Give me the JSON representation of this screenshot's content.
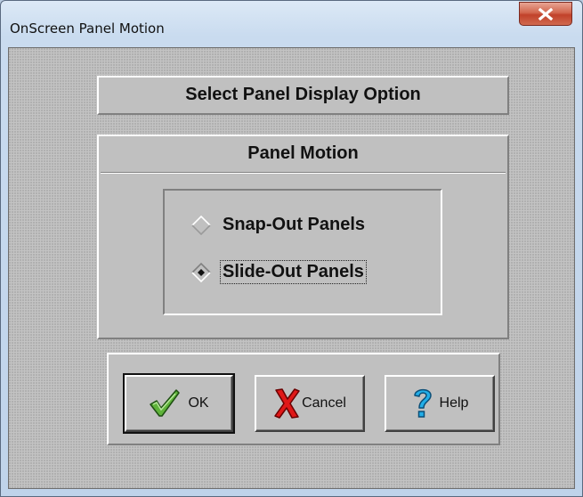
{
  "window": {
    "title": "OnScreen Panel Motion"
  },
  "header": {
    "text": "Select Panel Display Option"
  },
  "panel_motion": {
    "title": "Panel Motion",
    "options": [
      {
        "label": "Snap-Out Panels",
        "selected": false
      },
      {
        "label": "Slide-Out Panels",
        "selected": true
      }
    ]
  },
  "buttons": {
    "ok": "OK",
    "cancel": "Cancel",
    "help": "Help"
  },
  "icons": {
    "close": "close-icon",
    "ok": "checkmark-icon",
    "cancel": "red-x-icon",
    "help": "question-mark-icon"
  },
  "colors": {
    "ok_check": "#3c8a2a",
    "cancel_x": "#d01010",
    "help_question": "#1aa3e0",
    "close_button": "#c9452e"
  }
}
